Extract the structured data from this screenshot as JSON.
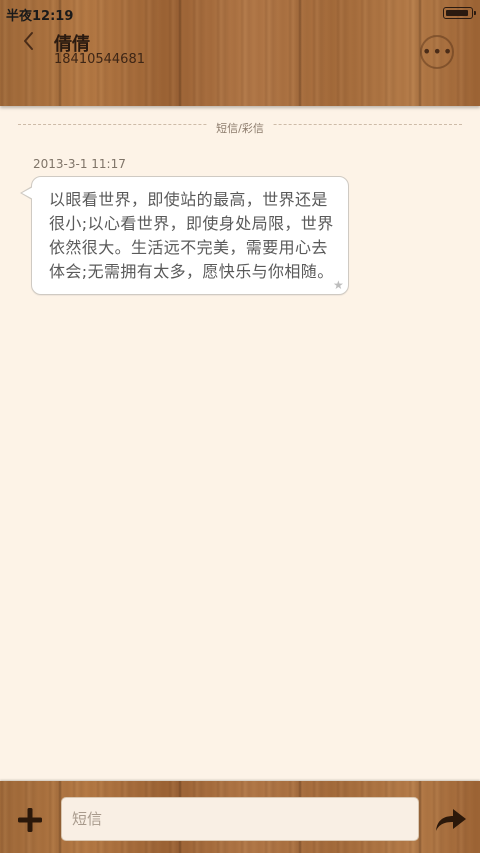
{
  "status_bar": {
    "time": "半夜12:19",
    "battery_level": 0.9
  },
  "header": {
    "contact_name": "倩倩",
    "contact_number": "18410544681",
    "back_icon": "chevron-left-icon",
    "more_icon": "more-dots-icon"
  },
  "conversation": {
    "divider_label": "短信/彩信",
    "messages": [
      {
        "timestamp": "2013-3-1 11:17",
        "text": "以眼看世界，即使站的最高，世界还是很小;以心看世界，即使身处局限，世界依然很大。生活远不完美，需要用心去体会;无需拥有太多，愿快乐与你相随。",
        "starred_icon": "star-icon"
      }
    ]
  },
  "composer": {
    "placeholder": "短信",
    "value": "",
    "add_icon": "plus-icon",
    "send_icon": "send-arrow-icon"
  },
  "colors": {
    "background": "#fdf3e7",
    "wood": "#a06a3a",
    "text_dark": "#2a1a10"
  }
}
